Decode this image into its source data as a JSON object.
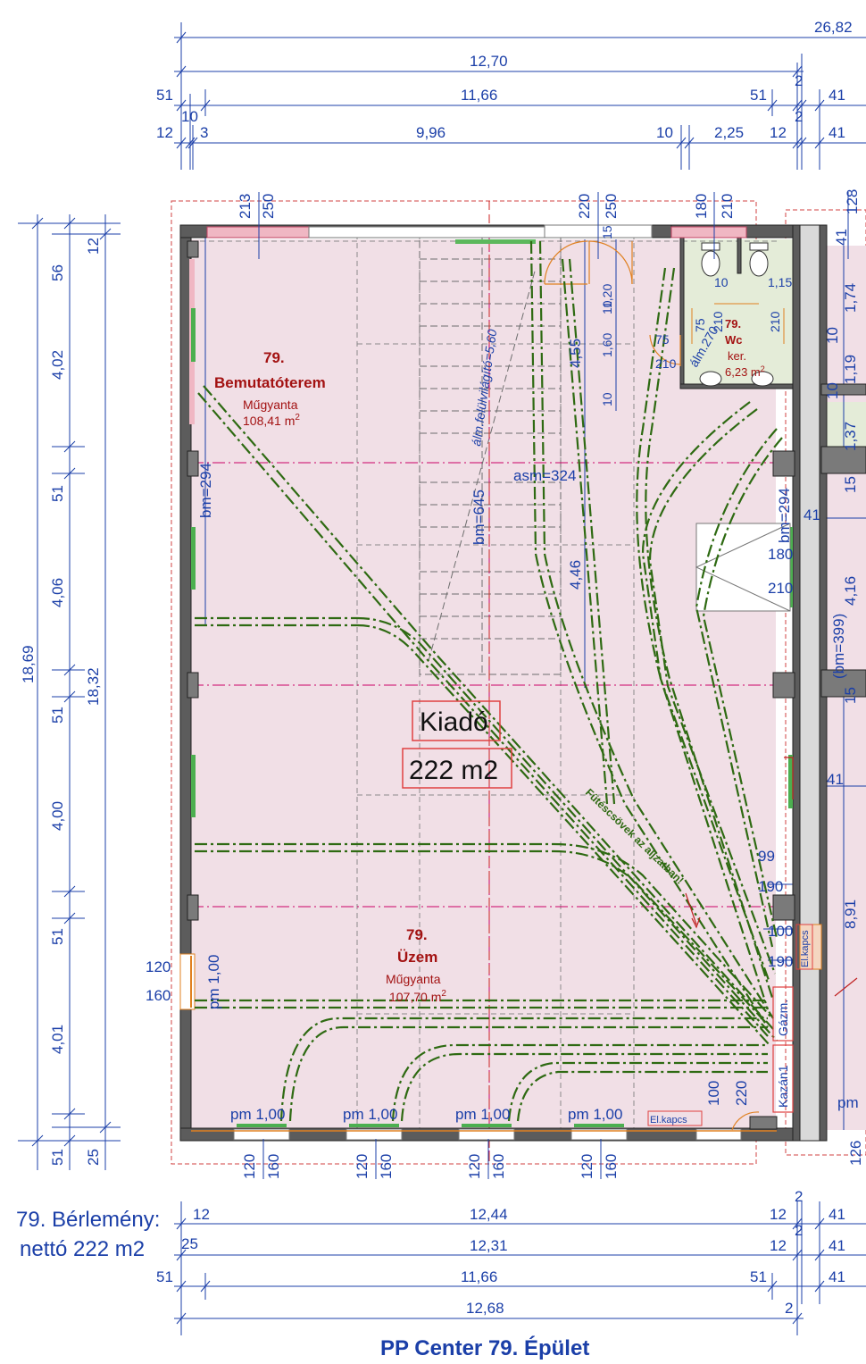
{
  "colors": {
    "dimension": "#1b3fa8",
    "wall": "#555555",
    "room_fill": "#f1dfe6",
    "room_label": "#a31212",
    "heating_pipe": "#2e6a12",
    "axis_line": "#cc0066",
    "outline_dash": "#d04040"
  },
  "top_dims": {
    "row1": [
      "26,82"
    ],
    "row2": [
      "12,70",
      "2"
    ],
    "row3": [
      "51",
      "11,66",
      "51",
      "2",
      "41"
    ],
    "row4": [
      "10",
      "12",
      "3",
      "9,96",
      "10",
      "2,25",
      "12",
      "41"
    ]
  },
  "opening_dims_top": [
    "213",
    "250",
    "220",
    "250",
    "180",
    "210",
    "128",
    "41"
  ],
  "left_dims": {
    "total": "18,69",
    "inner": "18,32",
    "segments": [
      "56",
      "12",
      "4,02",
      "51",
      "4,06",
      "51",
      "4,00",
      "51",
      "4,01",
      "51",
      "25"
    ]
  },
  "rooms": {
    "showroom": {
      "number": "79.",
      "name": "Bemutatóterem",
      "material": "Műgyanta",
      "area": "108,41 m",
      "area_sup": "2"
    },
    "workshop": {
      "number": "79.",
      "name": "Üzem",
      "material": "Műgyanta",
      "area": "107,70 m",
      "area_sup": "2"
    },
    "wc": {
      "number": "79.",
      "name": "Wc",
      "material": "ker.",
      "area": "6,23 m",
      "area_sup": "2"
    }
  },
  "main_label": {
    "status": "Kiadó",
    "area": "222 m2"
  },
  "interior_dims": {
    "bm_left": "bm=294",
    "bm_stair": "bm=645",
    "skylight": "álm.felülvilágító=5,60",
    "asm": "asm=324",
    "bm_right": "bm=294",
    "bm_right2": "(bm=399)",
    "v455": "4,55",
    "v446": "4,46",
    "v120": "1,20",
    "v160": "1,60",
    "v10a": "10",
    "v10b": "10",
    "v15": "15",
    "v180": "180",
    "v210": "210",
    "v41": "41",
    "v41b": "41",
    "v416": "4,16",
    "v15b": "15",
    "v891": "8,91",
    "v99": "99",
    "v190": "190",
    "v100": "100",
    "v190b": "190",
    "v120b": "120",
    "v160b": "160",
    "pm_left": "pm 1,00",
    "v100b": "100",
    "v220": "220",
    "v174": "1,74",
    "v119": "1,19",
    "v137": "1,37",
    "v10c": "10",
    "v10d": "10",
    "v15c": "15",
    "v126": "126",
    "wc_10": "10",
    "wc_115": "1,15",
    "wc_75a": "75",
    "wc_75b": "75",
    "wc_210a": "210",
    "wc_210b": "210",
    "wc_210c": "210",
    "wc_alm": "álm.270",
    "pm_right": "pm"
  },
  "bottom_windows": {
    "labels": [
      "pm 1,00",
      "pm 1,00",
      "pm 1,00",
      "pm 1,00"
    ],
    "dims": [
      "120",
      "160",
      "120",
      "160",
      "120",
      "160",
      "120",
      "160"
    ]
  },
  "heating_label": "Fűtéscsövek az aljzatban!",
  "equipment": {
    "gas_meter": "Gázm.",
    "boiler": "Kazán1",
    "el_switch": "El.kapcs",
    "el_switch_bottom": "El.kapcs"
  },
  "bottom_dims": {
    "row1": [
      "12",
      "12,44",
      "12",
      "2",
      "41"
    ],
    "row2": [
      "25",
      "12,31",
      "12",
      "2",
      "41"
    ],
    "row3": [
      "51",
      "11,66",
      "51",
      "41"
    ],
    "row4": [
      "12,68",
      "2"
    ]
  },
  "note": {
    "line1": "79. Bérlemény:",
    "line2": "nettó 222 m2"
  },
  "footer_title": "PP Center 79. Épület"
}
